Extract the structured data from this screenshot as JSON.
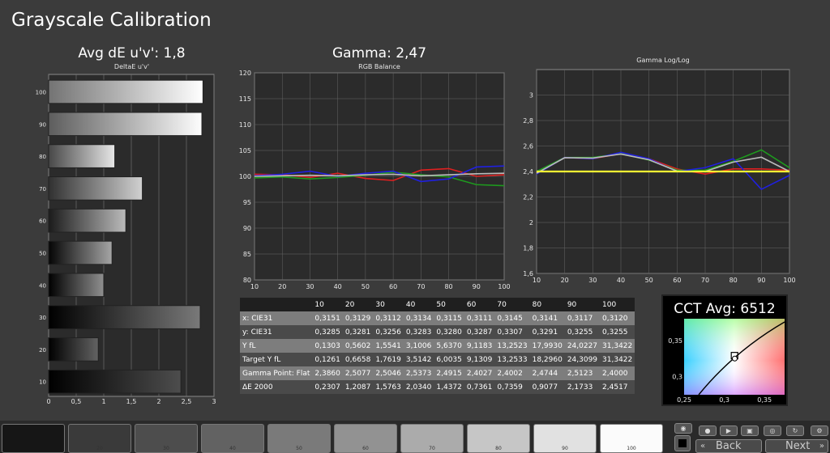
{
  "title": "Grayscale Calibration",
  "avg_de": "Avg dE u'v': 1,8",
  "gamma_title": "Gamma: 2,47",
  "cct_title": "CCT Avg: 6512",
  "colors": {
    "red": "#e02020",
    "green": "#1e9a1e",
    "blue": "#2020e0",
    "yellow": "#ffff33",
    "gray": "#bbbbbb",
    "plot_bg": "#2b2b2b"
  },
  "chart_data": [
    {
      "type": "bar",
      "title": "DeltaE u'v'",
      "orientation": "horizontal",
      "categories": [
        "100",
        "90",
        "80",
        "70",
        "60",
        "50",
        "40",
        "30",
        "20",
        "10"
      ],
      "values": [
        2.8,
        2.78,
        1.2,
        1.7,
        1.4,
        1.15,
        1.0,
        2.75,
        0.9,
        2.4
      ],
      "xlim": [
        0,
        3
      ],
      "xticks": [
        "0",
        "0,5",
        "1",
        "1,5",
        "2",
        "2,5",
        "3"
      ]
    },
    {
      "type": "line",
      "title": "RGB Balance",
      "x": [
        10,
        20,
        30,
        40,
        50,
        60,
        70,
        80,
        90,
        100
      ],
      "ylim": [
        80,
        120
      ],
      "yticks": [
        "80",
        "85",
        "90",
        "95",
        "100",
        "105",
        "110",
        "115",
        "120"
      ],
      "xticks": [
        "10",
        "20",
        "30",
        "40",
        "50",
        "60",
        "70",
        "80",
        "90",
        "100"
      ],
      "series": [
        {
          "color": "red",
          "values": [
            100.4,
            100.3,
            99.8,
            100.6,
            99.6,
            99.2,
            101.2,
            101.5,
            100.0,
            100.3
          ]
        },
        {
          "color": "green",
          "values": [
            99.7,
            99.9,
            99.5,
            99.8,
            100.2,
            100.8,
            100.3,
            99.9,
            98.4,
            98.2
          ]
        },
        {
          "color": "blue",
          "values": [
            100.1,
            100.4,
            101.0,
            100.0,
            100.6,
            101.0,
            99.0,
            99.5,
            101.8,
            102.0
          ]
        },
        {
          "color": "gray",
          "values": [
            100.0,
            100.1,
            100.2,
            100.1,
            100.3,
            100.4,
            100.1,
            100.3,
            100.5,
            100.6
          ]
        }
      ]
    },
    {
      "type": "line",
      "title": "Gamma Log/Log",
      "x": [
        10,
        20,
        30,
        40,
        50,
        60,
        70,
        80,
        90,
        100
      ],
      "ylim": [
        1.6,
        3.2
      ],
      "yticks": [
        "1,6",
        "1,8",
        "2",
        "2,2",
        "2,4",
        "2,6",
        "2,8",
        "3"
      ],
      "xticks": [
        "10",
        "20",
        "30",
        "40",
        "50",
        "60",
        "70",
        "80",
        "90",
        "100"
      ],
      "series": [
        {
          "color": "red",
          "values": [
            2.39,
            2.51,
            2.5,
            2.54,
            2.5,
            2.42,
            2.38,
            2.42,
            2.42,
            2.41
          ]
        },
        {
          "color": "green",
          "values": [
            2.4,
            2.51,
            2.51,
            2.54,
            2.49,
            2.41,
            2.41,
            2.48,
            2.57,
            2.43
          ]
        },
        {
          "color": "blue",
          "values": [
            2.38,
            2.51,
            2.5,
            2.55,
            2.5,
            2.4,
            2.43,
            2.5,
            2.26,
            2.37
          ]
        },
        {
          "color": "gray",
          "values": [
            2.386,
            2.508,
            2.505,
            2.537,
            2.492,
            2.403,
            2.4,
            2.474,
            2.512,
            2.4
          ]
        },
        {
          "color": "yellow",
          "values": [
            2.4,
            2.4,
            2.4,
            2.4,
            2.4,
            2.4,
            2.4,
            2.4,
            2.4,
            2.4
          ]
        }
      ]
    },
    {
      "type": "scatter",
      "title": "CCT Avg: 6512",
      "xlim": [
        0.25,
        0.375
      ],
      "ylim": [
        0.275,
        0.38
      ],
      "xticks": [
        "0,25",
        "0,3",
        "0,35"
      ],
      "yticks": [
        "0,3",
        "0,35"
      ],
      "points": [
        {
          "x": 0.3127,
          "y": 0.329
        },
        {
          "x": 0.313,
          "y": 0.325
        }
      ]
    }
  ],
  "table": {
    "header": [
      "",
      "10",
      "20",
      "30",
      "40",
      "50",
      "60",
      "70",
      "80",
      "90",
      "100"
    ],
    "rows": [
      [
        "x: CIE31",
        "0,3151",
        "0,3129",
        "0,3112",
        "0,3134",
        "0,3115",
        "0,3111",
        "0,3145",
        "0,3141",
        "0,3117",
        "0,3120"
      ],
      [
        "y: CIE31",
        "0,3285",
        "0,3281",
        "0,3256",
        "0,3283",
        "0,3280",
        "0,3287",
        "0,3307",
        "0,3291",
        "0,3255",
        "0,3255"
      ],
      [
        "Y fL",
        "0,1303",
        "0,5602",
        "1,5541",
        "3,1006",
        "5,6370",
        "9,1183",
        "13,2523",
        "17,9930",
        "24,0227",
        "31,3422"
      ],
      [
        "Target Y fL",
        "0,1261",
        "0,6658",
        "1,7619",
        "3,5142",
        "6,0035",
        "9,1309",
        "13,2533",
        "18,2960",
        "24,3099",
        "31,3422"
      ],
      [
        "Gamma Point: Flat",
        "2,3860",
        "2,5077",
        "2,5046",
        "2,5373",
        "2,4915",
        "2,4027",
        "2,4002",
        "2,4744",
        "2,5123",
        "2,4000"
      ],
      [
        "ΔE 2000",
        "0,2307",
        "1,2087",
        "1,5763",
        "2,0340",
        "1,4372",
        "0,7361",
        "0,7359",
        "0,9077",
        "2,1733",
        "2,4517"
      ]
    ]
  },
  "swatches": [
    {
      "label": "",
      "gray": "#161616"
    },
    {
      "label": "20",
      "gray": "#3a3a3a"
    },
    {
      "label": "30",
      "gray": "#4d4d4d"
    },
    {
      "label": "40",
      "gray": "#626262"
    },
    {
      "label": "50",
      "gray": "#7a7a7a"
    },
    {
      "label": "60",
      "gray": "#929292"
    },
    {
      "label": "70",
      "gray": "#ababab"
    },
    {
      "label": "80",
      "gray": "#c6c6c6"
    },
    {
      "label": "90",
      "gray": "#e1e1e1"
    },
    {
      "label": "100",
      "gray": "#fbfbfb"
    }
  ],
  "nav": {
    "back": "Back",
    "next": "Next"
  }
}
